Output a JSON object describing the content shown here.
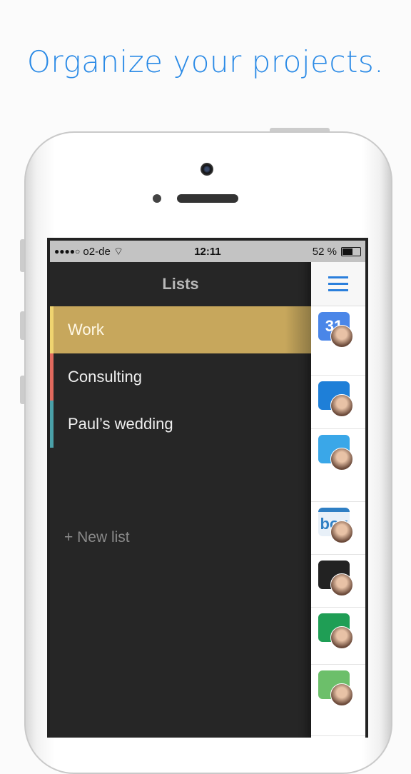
{
  "headline": "Organize your projects.",
  "status_bar": {
    "signal": "●●●●○",
    "carrier": "o2-de",
    "time": "12:11",
    "battery": "52 %",
    "battery_level": 0.52
  },
  "nav": {
    "title": "Lists"
  },
  "lists": [
    {
      "label": "Work",
      "color": "#f0d470",
      "active": true
    },
    {
      "label": "Consulting",
      "color": "#e06a5e",
      "active": false
    },
    {
      "label": "Paul’s wedding",
      "color": "#4aa0a8",
      "active": false
    }
  ],
  "new_list": "+ New list",
  "services": [
    {
      "icon": "google-calendar-icon",
      "label": "31",
      "color": "#4a86e8"
    },
    {
      "icon": "dropbox-icon",
      "label": "",
      "color": "#1e7fd8"
    },
    {
      "icon": "twitter-icon",
      "label": "",
      "color": "#3aa7e8"
    },
    {
      "icon": "box-icon",
      "label": "box",
      "color": "#2f7fc4"
    },
    {
      "icon": "github-icon",
      "label": "",
      "color": "#222222"
    },
    {
      "icon": "google-drive-icon",
      "label": "",
      "color": "#1f9e55"
    },
    {
      "icon": "basecamp-icon",
      "label": "",
      "color": "#6cbf6a"
    }
  ],
  "accent": "#2a8ae6"
}
